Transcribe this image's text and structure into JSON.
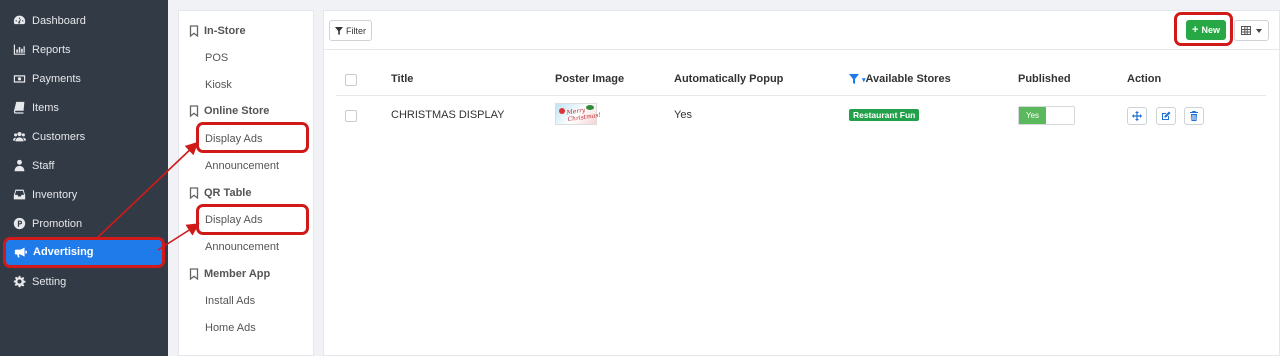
{
  "sidebar": {
    "items": [
      {
        "label": "Dashboard",
        "icon": "dashboard-icon"
      },
      {
        "label": "Reports",
        "icon": "bar-chart-icon"
      },
      {
        "label": "Payments",
        "icon": "money-icon"
      },
      {
        "label": "Items",
        "icon": "book-icon"
      },
      {
        "label": "Customers",
        "icon": "users-icon"
      },
      {
        "label": "Staff",
        "icon": "staff-icon"
      },
      {
        "label": "Inventory",
        "icon": "inbox-icon"
      },
      {
        "label": "Promotion",
        "icon": "promotion-icon"
      },
      {
        "label": "Advertising",
        "icon": "bullhorn-icon",
        "active": true
      },
      {
        "label": "Setting",
        "icon": "gear-icon"
      }
    ]
  },
  "submenu": {
    "groups": [
      {
        "label": "In-Store",
        "items": [
          "POS",
          "Kiosk"
        ]
      },
      {
        "label": "Online Store",
        "items": [
          "Display Ads",
          "Announcement"
        ]
      },
      {
        "label": "QR Table",
        "items": [
          "Display Ads",
          "Announcement"
        ]
      },
      {
        "label": "Member App",
        "items": [
          "Install Ads",
          "Home Ads"
        ]
      }
    ]
  },
  "toolbar": {
    "filter_label": "Filter",
    "new_label": "New"
  },
  "table": {
    "columns": [
      "Title",
      "Poster Image",
      "Automatically Popup",
      "Available Stores",
      "Published",
      "Action"
    ],
    "rows": [
      {
        "title": "CHRISTMAS DISPLAY",
        "poster_text": "Merry Christmas!",
        "auto_popup": "Yes",
        "store": "Restaurant Fun",
        "published": "Yes"
      }
    ]
  },
  "colors": {
    "sidebar_bg": "#323a45",
    "active_bg": "#1f7bea",
    "accent_green": "#28a745",
    "highlight_red": "#d01a1a"
  }
}
